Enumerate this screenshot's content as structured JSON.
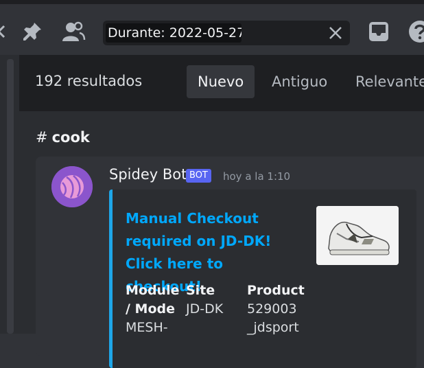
{
  "search": {
    "query": "Durante: 2022-05-27"
  },
  "results": {
    "count_label": "192 resultados",
    "tabs": [
      {
        "label": "Nuevo",
        "active": true
      },
      {
        "label": "Antiguo",
        "active": false
      },
      {
        "label": "Relevante",
        "active": false
      }
    ]
  },
  "channel": {
    "hash": "#",
    "name": "cook"
  },
  "message": {
    "author": "Spidey Bot",
    "bot_tag": "BOT",
    "timestamp": "hoy a la 1:10",
    "embed": {
      "title": "Manual Checkout required on JD-DK! Click here to checkout!",
      "accent_color": "#1ea6e8",
      "fields": [
        {
          "name": "Module / Mode",
          "value": "MESH-"
        },
        {
          "name": "Site",
          "value": "JD-DK"
        },
        {
          "name": "Product",
          "value": "529003 _jdsport"
        }
      ]
    }
  },
  "colors": {
    "background": "#313338",
    "header": "#1e1f22",
    "link": "#00a8fc",
    "bot_tag": "#5865f2"
  },
  "icons": [
    "chevron-left-icon",
    "pin-icon",
    "people-icon",
    "close-icon",
    "inbox-icon",
    "help-icon"
  ]
}
